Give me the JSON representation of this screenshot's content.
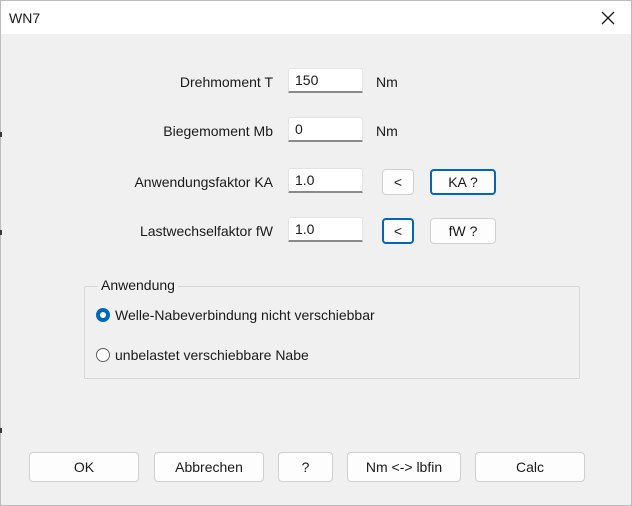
{
  "window": {
    "title": "WN7"
  },
  "fields": [
    {
      "label": "Drehmoment T",
      "value": "150",
      "unit": "Nm"
    },
    {
      "label": "Biegemoment Mb",
      "value": "0",
      "unit": "Nm"
    },
    {
      "label": "Anwendungsfaktor KA",
      "value": "1.0",
      "arrow_label": "<",
      "help_label": "KA ?"
    },
    {
      "label": "Lastwechselfaktor fW",
      "value": "1.0",
      "arrow_label": "<",
      "help_label": "fW ?"
    }
  ],
  "anwendung": {
    "legend": "Anwendung",
    "options": [
      {
        "label": "Welle-Nabeverbindung nicht verschiebbar",
        "selected": true
      },
      {
        "label": "unbelastet verschiebbare Nabe",
        "selected": false
      }
    ]
  },
  "buttons": {
    "ok": "OK",
    "cancel": "Abbrechen",
    "help": "?",
    "units": "Nm <-> lbfin",
    "calc": "Calc"
  },
  "colors": {
    "accent": "#0067c0",
    "dialog_bg": "#f0f0f0"
  }
}
